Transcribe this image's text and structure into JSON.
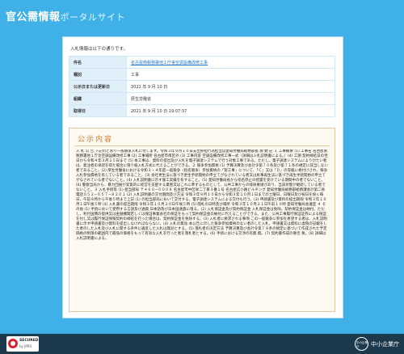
{
  "header": {
    "title_main": "官公需情報",
    "title_sub": "ポータルサイト"
  },
  "intro_text": "入札情報は以下の通りです。",
  "info_rows": [
    {
      "label": "件名",
      "value": "名古屋南税務署他１庁舎空調設備改修工事"
    },
    {
      "label": "種別",
      "value": "工事"
    },
    {
      "label": "公示日または更新日",
      "value": "2021 年 9 月 10 日"
    },
    {
      "label": "組織",
      "value": "厚生労働省"
    },
    {
      "label": "取得日",
      "value": "2021 年 9 月 10 日 19:07:37"
    }
  ],
  "notice": {
    "title": "公示内容",
    "body": "入 札 公 告 下記のとおり一般競争入札に付します。令和３年９月１０日支出負担行為担当官愛知労働局総務部長 堀 勉 記 １ 工事概要 (1) 工事名 名古屋南税務署他１庁舎空調設備改修工事 (2) 工事場所 名古屋市南区外 (3) 工事内容 空調設備改修工事一式（詳細は入札説明書による。）(4) 工期 契約締結日の翌日から令和４年３月２５日まで (5) 本工事は、資料の提出及び入札を電子調達システムで行う対象工事である。ただし、電子調達システムによりがたい者は、発注者の承諾を得た場合に限り紙入札方式に代えることができる。２ 競争参加資格 (1) 予算決算及び会計令第７０条及び第７１条の規定に該当しない者であること。(2) 厚生労働省における令和３・４年度一般競争（指名競争）参加資格の「管工事」について、「Ｃ」又は「Ｄ」の等級に格付けされ、競争入札参加資格を有している者であること。(3) 会社更生法に基づき更生手続開始の申立てがなされている者又は民事再生法に基づき再生手続開始の申立てがなされている者でないこと。(4) 入札説明書に示す施工実績を有すること。(5) 愛知労働局長から指名停止の措置を受けている期間中の者でないこと。(6) 警察当局から、暴力団員が実質的に経営を支配する業者又はこれに準ずるものとして、公共工事からの排除要請があり、当該状態が継続している者でないこと。３ 入札手続等 (1) 担当部局 〒４６０−０００８ 名古屋市中区栄二丁目３番１号 名古屋広小路ビルヂング 愛知労働局総務部総務課会計第二係 電話０５２−６５７−８２０１ (2) 入札説明書の交付期間及び方法 令和３年９月１０日から令和３年１０月１日までの土曜日、日曜日及び祝日を除く毎日、午前９時から午後５時まで上記 (1) の担当部局において交付する。電子調達システムによる交付も行う。(3) 申請書及び資料の提出期限 令和３年１０月１日午後５時 (4) 入札書の提出期限 令和３年１０月２０日午後５時 (5) 開札の日時及び場所 令和３年１０月２１日午前１０時 愛知労働局会議室 ４ その他 (1) 手続において使用する言語及び通貨 日本語及び日本国通貨に限る。(2) 入札保証金及び契約保証金 入札保証金は免除。契約保証金は納付。ただし、利付国債の提供又は金融機関若しくは保証事業会社の保証をもって契約保証金の納付に代えることができる。また、公共工事履行保証証券による保証を付し又は履行保証保険契約の締結を行った場合は、契約保証金を免除する。(3) 入札者に要求される事項 この一般競争に参加を希望する者は、入札説明書に示す申請書及び資料を提出しなければならない。(4) 入札の無効 本公告に示した競争参加資格のない者のした入札、申請書又は資料に虚偽の記載をした者のした入札及び入札に関する条件に違反した入札は無効とする。(5) 落札者の決定方法 予算決算及び会計令第７９条の規定に基づいて作成された予定価格の制限の範囲内で最低の価格をもって有効な入札を行った者を落札者とする。(6) 手続における交渉の有無 無。(7) 契約書作成の要否 要。(8) 詳細は入札説明書による。"
  },
  "footer": {
    "badge_line1": "SECURED",
    "badge_line2": "by JPRS",
    "logo_text": "中小企業庁",
    "sme_name": "中小企業庁"
  }
}
